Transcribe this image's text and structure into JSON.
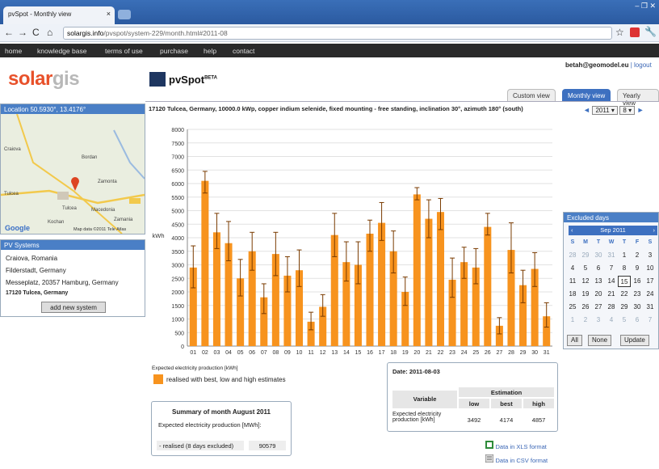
{
  "browser": {
    "tab_title": "pvSpot - Monthly view",
    "tab_close": "×",
    "url_domain": "solargis.info",
    "url_path": "/pvspot/system-229/month.html#2011-08",
    "window_controls": "– ❐ ✕"
  },
  "site_nav": [
    "home",
    "knowledge base",
    "terms of use",
    "purchase",
    "help",
    "contact"
  ],
  "header": {
    "logo_part1": "solar",
    "logo_part2": "gis",
    "product": "pvSpot",
    "product_tag": "BETA",
    "user_email": "betah@geomodel.eu",
    "separator": " | ",
    "logout": "logout"
  },
  "view_tabs": [
    "Custom view",
    "Monthly view",
    "Yearly view"
  ],
  "active_view_tab": "Monthly view",
  "location": {
    "header": "Location 50.5930°, 13.4176°",
    "map_labels": [
      "Craiova",
      "Bordan",
      "Tulcea",
      "Zamonta",
      "Tulcea",
      "Kochan",
      "Macedonia",
      "Zamania"
    ],
    "map_footer": "Map data ©2011 Tele Atlas"
  },
  "pv_systems": {
    "header": "PV Systems",
    "items": [
      "Craiova, Romania",
      "Filderstadt, Germany",
      "Messeplatz, 20357 Hamburg, Germany",
      "17120 Tulcea, Germany"
    ],
    "add_button": "add new system"
  },
  "chart_title": "17120 Tulcea, Germany, 10000.0 kWp, copper indium selenide, fixed mounting - free standing, inclination 30°, azimuth 180° (south)",
  "month_selector": {
    "year": "2011",
    "month": "8"
  },
  "chart_data": {
    "type": "bar",
    "ylabel": "kWh",
    "ylim": [
      0,
      8000
    ],
    "yticks": [
      0,
      500,
      1000,
      1500,
      2000,
      2500,
      3000,
      3500,
      4000,
      4500,
      5000,
      5500,
      6000,
      6500,
      7000,
      7500,
      8000
    ],
    "categories": [
      "01",
      "02",
      "03",
      "04",
      "05",
      "06",
      "07",
      "08",
      "09",
      "10",
      "11",
      "12",
      "13",
      "14",
      "15",
      "16",
      "17",
      "18",
      "19",
      "20",
      "21",
      "22",
      "23",
      "24",
      "25",
      "26",
      "27",
      "28",
      "29",
      "30",
      "31"
    ],
    "values": [
      2900,
      6100,
      4200,
      3800,
      2500,
      3500,
      1800,
      3400,
      2600,
      2800,
      900,
      1450,
      4100,
      3100,
      3000,
      4150,
      4550,
      3500,
      2000,
      5600,
      4700,
      4950,
      2450,
      3100,
      2900,
      4400,
      750,
      3550,
      2250,
      2850,
      1100
    ],
    "low": [
      2150,
      5650,
      3600,
      3150,
      1850,
      2800,
      1200,
      2600,
      2000,
      2200,
      600,
      1100,
      3300,
      2400,
      2300,
      3500,
      3900,
      2700,
      1500,
      5400,
      4000,
      4300,
      1800,
      2500,
      2300,
      4100,
      450,
      2700,
      1600,
      2200,
      700
    ],
    "high": [
      3700,
      6450,
      4900,
      4600,
      3200,
      4200,
      2300,
      4200,
      3300,
      3550,
      1250,
      1900,
      4900,
      3850,
      3850,
      4650,
      5300,
      4250,
      2550,
      5850,
      5400,
      5450,
      3250,
      3650,
      3600,
      4900,
      1050,
      4550,
      2800,
      3450,
      1600
    ],
    "series": [
      {
        "name": "realised with best, low and high estimates",
        "values_ref": "values"
      }
    ]
  },
  "legend": {
    "title": "Expected electricity production [kWh]",
    "item": "realised with best, low and high estimates"
  },
  "excluded_days": {
    "header": "Excluded days",
    "month_label": "Sep 2011",
    "prev": "‹",
    "next": "›",
    "weekdays": [
      "S",
      "M",
      "T",
      "W",
      "T",
      "F",
      "S"
    ],
    "weeks": [
      [
        "28",
        "29",
        "30",
        "31",
        "1",
        "2",
        "3"
      ],
      [
        "4",
        "5",
        "6",
        "7",
        "8",
        "9",
        "10"
      ],
      [
        "11",
        "12",
        "13",
        "14",
        "15",
        "16",
        "17"
      ],
      [
        "18",
        "19",
        "20",
        "21",
        "22",
        "23",
        "24"
      ],
      [
        "25",
        "26",
        "27",
        "28",
        "29",
        "30",
        "31"
      ],
      [
        "1",
        "2",
        "3",
        "4",
        "5",
        "6",
        "7"
      ]
    ],
    "buttons": [
      "All",
      "None",
      "Update"
    ]
  },
  "summary": {
    "title": "Summary of month August 2011",
    "label": "Expected electricity production [MWh]:",
    "row_label": "- realised (8 days excluded)",
    "row_value": "90579"
  },
  "estimation": {
    "date": "Date: 2011-08-03",
    "col_variable": "Variable",
    "col_group": "Estimation",
    "cols": [
      "low",
      "best",
      "high"
    ],
    "row_label": "Expected electricity production [kWh]",
    "values": [
      "3492",
      "4174",
      "4857"
    ]
  },
  "downloads": [
    "Data in XLS format",
    "Data in CSV format"
  ],
  "colors": {
    "bar": "#f7931e",
    "accent": "#3d70c0",
    "logo": "#e8512a"
  }
}
